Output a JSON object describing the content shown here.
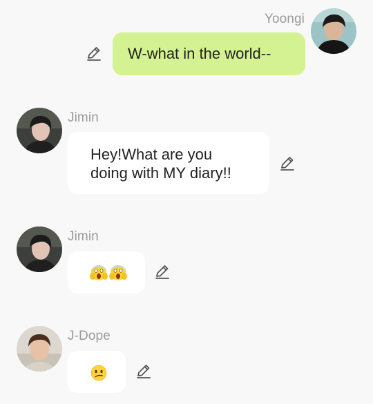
{
  "messages": [
    {
      "sender": "Yoongi",
      "text": "W-what in the world--",
      "side": "right",
      "avatar": "photo-avatar-dark-hair-black-shirt",
      "bubble_color": "#d4f291"
    },
    {
      "sender": "Jimin",
      "text": "Hey!What are you\ndoing with MY diary!!",
      "side": "left",
      "avatar": "photo-avatar-dark-hair",
      "bubble_color": "#ffffff"
    },
    {
      "sender": "Jimin",
      "emojis": [
        "face-screaming-in-fear",
        "face-screaming-in-fear"
      ],
      "side": "left",
      "avatar": "photo-avatar-dark-hair",
      "bubble_color": "#ffffff"
    },
    {
      "sender": "J-Dope",
      "emojis": [
        "confused-face"
      ],
      "side": "left",
      "avatar": "photo-avatar-light-hair",
      "bubble_color": "#ffffff"
    }
  ],
  "icons": {
    "edit": "pencil-icon"
  },
  "colors": {
    "background": "#f8f8f8",
    "sender_name": "#9a9a9a",
    "own_bubble": "#d4f291",
    "other_bubble": "#ffffff",
    "text": "#222222",
    "icon": "#555555"
  }
}
